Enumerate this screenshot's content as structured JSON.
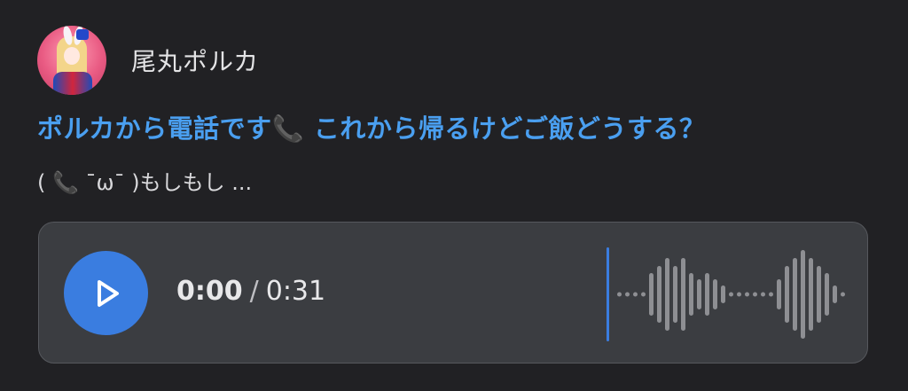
{
  "post": {
    "author": "尾丸ポルカ",
    "avatar_icon": "user-avatar",
    "title": "ポルカから電話です📞 これから帰るけどご飯どうする？",
    "subtitle": "(  📞 ˉωˉ )もしもし ...",
    "title_color": "#4a9ff0"
  },
  "audio": {
    "play_icon": "play-icon",
    "current_time": "0:00",
    "separator": "/",
    "duration": "0:31",
    "progress": 0,
    "accent": "#3a7de0"
  }
}
